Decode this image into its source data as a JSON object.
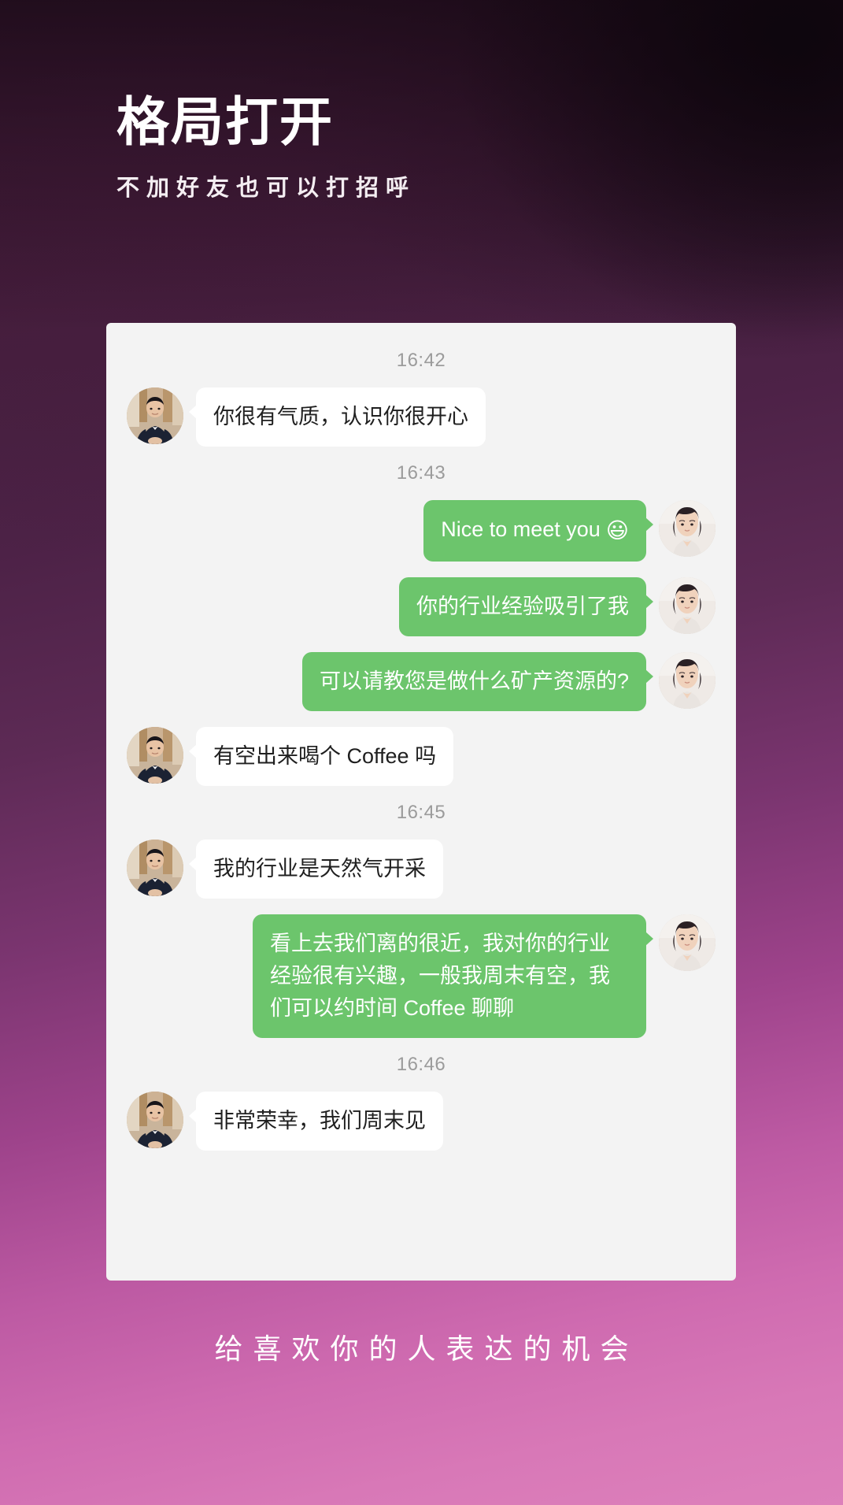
{
  "poster": {
    "headline": "格局打开",
    "subhead": "不加好友也可以打招呼",
    "footer_caption": "给喜欢你的人表达的机会",
    "colors": {
      "bubble_outgoing": "#6cc56c",
      "bubble_incoming": "#ffffff",
      "panel_bg": "#f3f3f3",
      "timestamp": "#9b9b9b",
      "headline": "#ffffff"
    }
  },
  "chat": {
    "groups": [
      {
        "timestamp": "16:42",
        "messages": [
          {
            "side": "incoming",
            "text": "你很有气质，认识你很开心",
            "avatar": "avatar-man",
            "emoji": ""
          }
        ]
      },
      {
        "timestamp": "16:43",
        "messages": [
          {
            "side": "outgoing",
            "text": "Nice to meet you",
            "avatar": "avatar-woman",
            "emoji": "😃"
          },
          {
            "side": "outgoing",
            "text": "你的行业经验吸引了我",
            "avatar": "avatar-woman",
            "emoji": ""
          },
          {
            "side": "outgoing",
            "text": "可以请教您是做什么矿产资源的?",
            "avatar": "avatar-woman",
            "emoji": ""
          },
          {
            "side": "incoming",
            "text": "有空出来喝个 Coffee 吗",
            "avatar": "avatar-man",
            "emoji": ""
          }
        ]
      },
      {
        "timestamp": "16:45",
        "messages": [
          {
            "side": "incoming",
            "text": "我的行业是天然气开采",
            "avatar": "avatar-man",
            "emoji": ""
          },
          {
            "side": "outgoing",
            "text": "看上去我们离的很近，我对你的行业经验很有兴趣，一般我周末有空，我们可以约时间 Coffee 聊聊",
            "avatar": "avatar-woman",
            "emoji": ""
          }
        ]
      },
      {
        "timestamp": "16:46",
        "messages": [
          {
            "side": "incoming",
            "text": "非常荣幸，我们周末见",
            "avatar": "avatar-man",
            "emoji": ""
          }
        ]
      }
    ]
  }
}
